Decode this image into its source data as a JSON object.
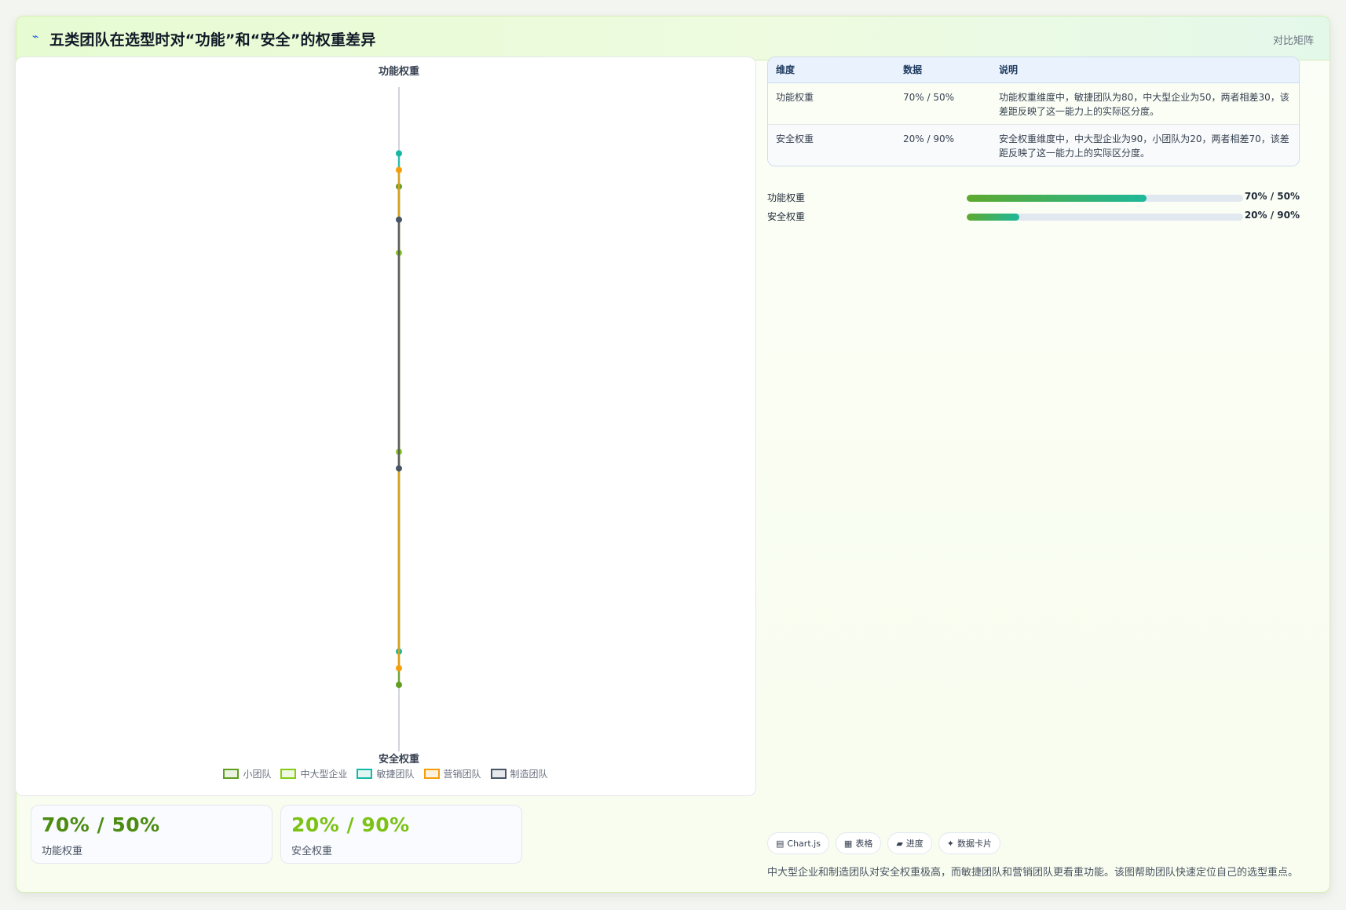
{
  "header": {
    "icon": "trend-icon",
    "title": "五类团队在选型时对“功能”和“安全”的权重差异",
    "tag": "对比矩阵"
  },
  "chart_data": {
    "type": "line",
    "axes": [
      "功能权重",
      "安全权重"
    ],
    "ylim": [
      0,
      100
    ],
    "series": [
      {
        "name": "小团队",
        "values": [
          70,
          20
        ],
        "color": "#5f9e1e"
      },
      {
        "name": "中大型企业",
        "values": [
          50,
          90
        ],
        "color": "#84cc16"
      },
      {
        "name": "敏捷团队",
        "values": [
          80,
          30
        ],
        "color": "#14b8a6"
      },
      {
        "name": "营销团队",
        "values": [
          75,
          25
        ],
        "color": "#f59e0b"
      },
      {
        "name": "制造团队",
        "values": [
          60,
          85
        ],
        "color": "#475569"
      }
    ]
  },
  "stats": [
    {
      "value": "70% / 50%",
      "label": "功能权重",
      "color": "#4d8c12"
    },
    {
      "value": "20% / 90%",
      "label": "安全权重",
      "color": "#7cc215"
    }
  ],
  "table": {
    "headers": [
      "维度",
      "数据",
      "说明"
    ],
    "rows": [
      {
        "dim": "功能权重",
        "data": "70% / 50%",
        "desc": "功能权重维度中，敏捷团队为80，中大型企业为50，两者相差30，该差距反映了这一能力上的实际区分度。"
      },
      {
        "dim": "安全权重",
        "data": "20% / 90%",
        "desc": "安全权重维度中，中大型企业为90，小团队为20，两者相差70，该差距反映了这一能力上的实际区分度。"
      }
    ]
  },
  "bars": [
    {
      "label": "功能权重",
      "fill": 0.65,
      "value": "70% / 50%"
    },
    {
      "label": "安全权重",
      "fill": 0.19,
      "value": "20% / 90%"
    }
  ],
  "chips": [
    {
      "icon": "chart-icon",
      "glyph": "▤",
      "label": "Chart.js"
    },
    {
      "icon": "table-icon",
      "glyph": "▦",
      "label": "表格"
    },
    {
      "icon": "progress-icon",
      "glyph": "▰",
      "label": "进度"
    },
    {
      "icon": "sparkle-icon",
      "glyph": "✦",
      "label": "数据卡片"
    }
  ],
  "footnote": "中大型企业和制造团队对安全权重极高，而敏捷团队和营销团队更看重功能。该图帮助团队快速定位自己的选型重点。"
}
